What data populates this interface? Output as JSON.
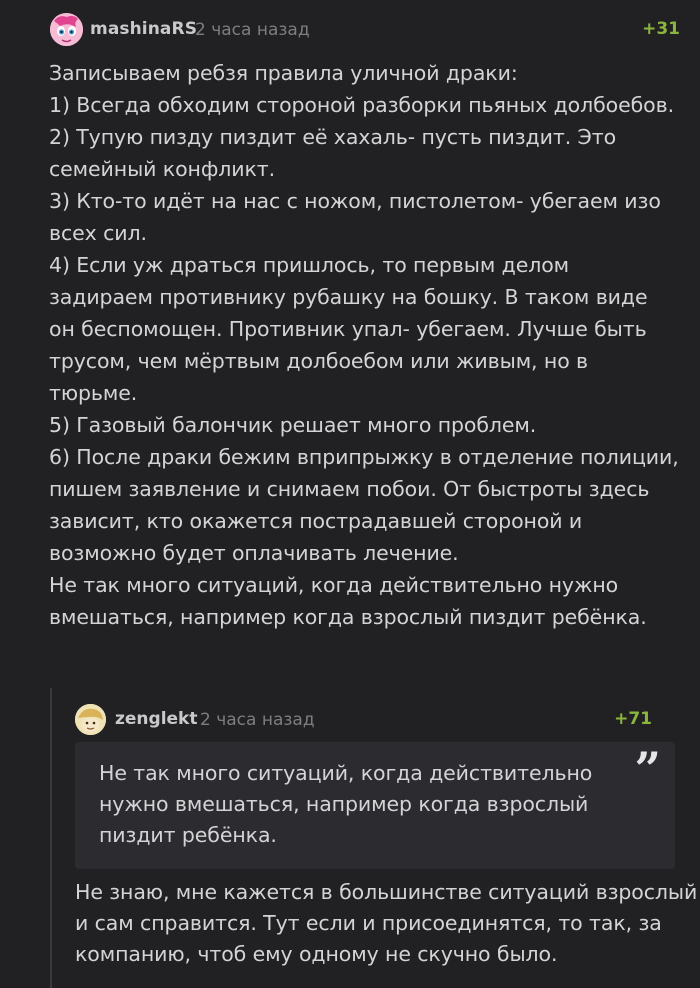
{
  "comment": {
    "author": "mashinaRS",
    "time": "2 часа назад",
    "rating": "+31",
    "avatar_icon": "pink-pony-avatar",
    "text": "Записываем ребзя правила уличной драки:\n1) Всегда обходим стороной разборки пьяных долбоебов.\n2) Тупую пизду пиздит её хахаль- пусть пиздит. Это семейный конфликт.\n3) Кто-то идёт на нас с ножом, пистолетом- убегаем изо всех сил.\n4) Если уж драться пришлось, то первым делом задираем противнику рубашку на бошку. В таком виде он беспомощен. Противник упал- убегаем. Лучше быть трусом, чем мёртвым долбоебом или живым, но в тюрьме.\n5) Газовый балончик решает много проблем.\n6) После драки бежим вприпрыжку в отделение полиции, пишем заявление и снимаем побои. От быстроты здесь зависит, кто окажется пострадавшей стороной и возможно будет оплачивать лечение.\nНе так много ситуаций, когда действительно нужно вмешаться, например когда взрослый пиздит ребёнка."
  },
  "reply": {
    "author": "zenglekt",
    "time": "2 часа назад",
    "rating": "+71",
    "avatar_icon": "cartoon-character-avatar",
    "quote_mark": "”",
    "quote_text": "Не так много ситуаций, когда действительно нужно вмешаться, например когда взрослый пиздит ребёнка.",
    "text": "Не знаю, мне кажется в большинстве ситуаций взрослый и сам справится. Тут если и присоединятся, то так, за компанию, чтоб ему одному не скучно было."
  },
  "colors": {
    "background": "#212124",
    "text": "#d4d4d6",
    "meta": "#7d7d82",
    "rating": "#8ab63e",
    "quote_bg": "#2c2c30"
  }
}
